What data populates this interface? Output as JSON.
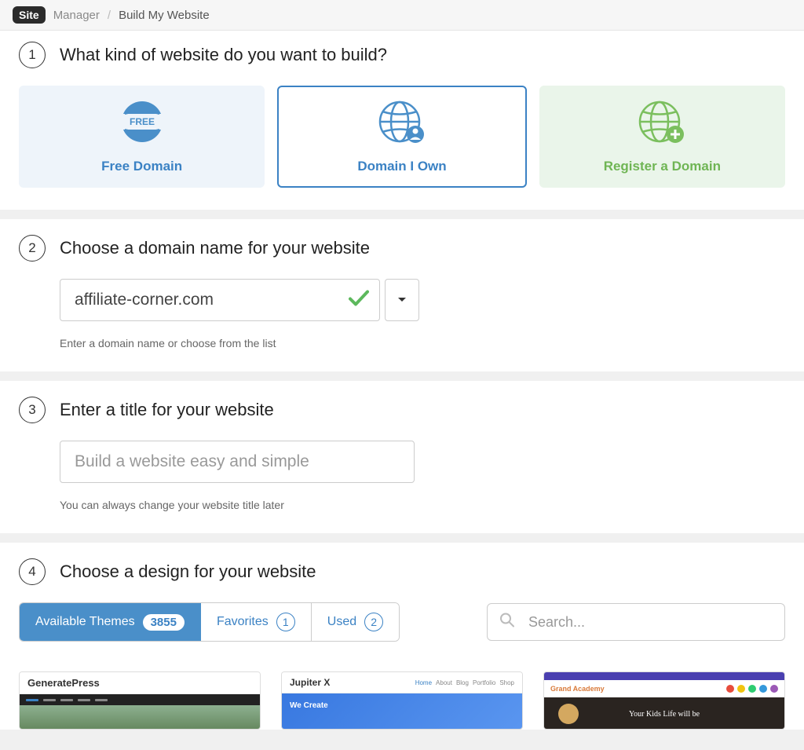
{
  "breadcrumb": {
    "site_badge": "Site",
    "manager": "Manager",
    "current": "Build My Website"
  },
  "step1": {
    "number": "1",
    "title": "What kind of website do you want to build?",
    "options": {
      "free": {
        "label": "Free Domain",
        "badge": "FREE"
      },
      "own": {
        "label": "Domain I Own"
      },
      "register": {
        "label": "Register a Domain"
      }
    }
  },
  "step2": {
    "number": "2",
    "title": "Choose a domain name for your website",
    "domain_value": "affiliate-corner.com",
    "helper": "Enter a domain name or choose from the list"
  },
  "step3": {
    "number": "3",
    "title": "Enter a title for your website",
    "placeholder": "Build a website easy and simple",
    "helper": "You can always change your website title later"
  },
  "step4": {
    "number": "4",
    "title": "Choose a design for your website",
    "tabs": {
      "available": {
        "label": "Available Themes",
        "count": "3855"
      },
      "favorites": {
        "label": "Favorites",
        "count": "1"
      },
      "used": {
        "label": "Used",
        "count": "2"
      }
    },
    "search_placeholder": "Search...",
    "themes": {
      "t1": {
        "name": "GeneratePress"
      },
      "t2": {
        "name": "Jupiter X",
        "hero": "We Create"
      },
      "t3": {
        "name": "Grand Academy",
        "hero": "Your Kids Life will be"
      }
    }
  }
}
